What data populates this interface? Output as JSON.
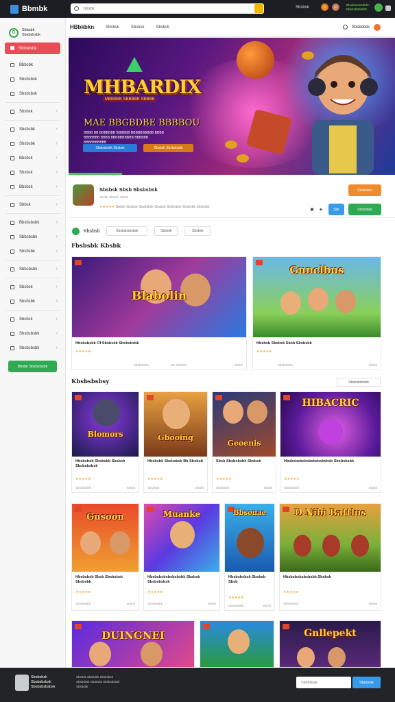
{
  "topbar": {
    "logo": "Bbmbk",
    "search_placeholder": "Sbsbk",
    "nav_link": "Sbsbsk",
    "user_text": "Bhubkubinbbbbn Bbbbnbbbbbbb"
  },
  "sidebar": {
    "title": "Sbbsbk Sbsbsbsbk",
    "active": "Sbbsbsbk",
    "items": [
      "Bbbsbk",
      "Sbsbsbsk",
      "Sbsbsbsk",
      "Sbsbsk",
      "Sbsbsbk",
      "Sbsbsbk",
      "Bbsbsk",
      "Sbsbsk",
      "Bbsbsk",
      "Sbsbsbk",
      "Sbbsk",
      "Bbsbsbsbk",
      "Sbbsbsbk",
      "Sbsbsbk",
      "Sbbsbsbk",
      "Sbsbsk",
      "Sbsbsbk",
      "Sbsbsk",
      "Sbsbsbsbk",
      "Sbsbsbsbk"
    ],
    "cta": "Bbsbk Sbsbsbsbk"
  },
  "subnav": {
    "brand": "HBbkbkn",
    "tabs": [
      "Sbsbsk",
      "Sbsbsk",
      "Sbsbsk"
    ],
    "right_label": "Sbsbsbsk"
  },
  "hero": {
    "title": "MHBARDIX",
    "subtitle": "MBBBBK SBBBBK SBBBB",
    "headline": "MAE BBGBDBE BBBBOU",
    "desc": "BBBB BB BBBBBBB BBBBBB BBBBBBBBBB BBBB BBBBBBB BBBB BBBBBBBBBB BBBBBB BBBBBBBBBB",
    "btn_primary": "Sbsbsbsbk Sbsbsk",
    "btn_secondary": "Sbsbsk Sbsbsbsbk"
  },
  "featured_app": {
    "name": "Sbsbsk Sbsb Sbsbsbsk",
    "meta": "Sbsbk Sbsbsk Sbsbk",
    "rating_stars": "★★★★★",
    "rating_text": "Sbsbk  Sbsbsk Sbsbsbsk Sbsbsk Sbsbsbsk Sbsbsbk Sbsbsbk",
    "btn_top": "Sbsbsbsk",
    "btn_small": "Sbk",
    "btn_green": "Sbsbsbsk"
  },
  "filters": {
    "label": "Kbsbsb",
    "chips": [
      "Sbsbsbsbsbsk",
      "Sbsbsk",
      "Sbsbsk"
    ]
  },
  "section1": {
    "title": "Fbsbsbk Kbsbk",
    "cards": [
      {
        "title_art": "Blabolin",
        "name": "Hbsbsbsbk Of Sbsbsbk Sbsbsbsbk",
        "stars": "★★★★★",
        "meta_left": "Sbsbsbsbk",
        "meta_mid": "Sb Sbsbsbk",
        "meta_right": "Sbsbk"
      },
      {
        "title_art": "Gunclbus",
        "name": "Hbsbsb Sbsbsk Sbsb Sbsbsbk",
        "stars": "★★★★★",
        "meta_left": "Sbsbsbsbk",
        "meta_right": "Sbsbk"
      }
    ]
  },
  "section2": {
    "title": "Kbsbsbsbsy",
    "button": "Sbsbsbsbsbk",
    "cards": [
      {
        "title_art": "Blomors",
        "name": "Hbsbsbsb Sbsbsbk Sbsbsb Sbsbsbsbsk",
        "stars": "★★★★★",
        "meta_left": "Sbsbsbsbk",
        "meta_right": "Sbsbk"
      },
      {
        "title_art": "Gbooing",
        "name": "Hbsbsbk Sbsbsbsk Bb Sbsbsb",
        "stars": "★★★★★",
        "meta_left": "Sbsbsbk",
        "meta_right": "Sbsbk"
      },
      {
        "title_art": "Geoenis",
        "name": "Sbsb Sbsbsbsbk Sbsbsb",
        "stars": "★★★★★",
        "meta_left": "Sbsbsbsk",
        "meta_right": "Sbsbk"
      },
      {
        "title_art": "HIBACRIC",
        "name": "Hbsbsbsbsbsbsbsbsbsbsk Sbsbsbsbk",
        "stars": "★★★★★",
        "meta_left": "Sbsbsbsbk",
        "meta_right": "Sbsbk"
      },
      {
        "title_art": "Gusoon",
        "name": "Hbsbsbsb Sbsb Sbsbsbsk Sbsbsbk",
        "stars": "★★★★★",
        "meta_left": "Sbsbsbsbk",
        "meta_right": "Sbsbk"
      },
      {
        "title_art": "Muanke",
        "name": "Hbsbsbsbsbsbsbsbk Sbsbsb Sbsbsbsbsk",
        "stars": "★★★★★",
        "meta_left": "Sbsbsbsbk",
        "meta_right": "Sbsbk"
      },
      {
        "title_art": "Bbsonae",
        "name": "Hbsbsbsbsk Sbsbsb Sbsb",
        "stars": "★★★★★",
        "meta_left": "Sbsbsbsbk",
        "meta_right": "Sbsbk"
      },
      {
        "title_art": "D Nibi Battlus",
        "name": "Hbsbsbsbsbsbsbk Sbsbsk",
        "stars": "★★★★★",
        "meta_left": "Sbsbsbsbk",
        "meta_right": "Sbsbk"
      },
      {
        "title_art": "DUINGNEI",
        "name": "",
        "stars": "",
        "meta_left": "",
        "meta_right": ""
      },
      {
        "title_art": "",
        "name": "",
        "stars": "",
        "meta_left": "",
        "meta_right": ""
      },
      {
        "title_art": "Gnllepekt",
        "name": "",
        "stars": "",
        "meta_left": "",
        "meta_right": ""
      }
    ]
  },
  "footer": {
    "brand": "Sbsbsbsk Sbsbsbsbsk Sbsbsbsbsbsk",
    "col": "Sbsbsk Sbsbsbk Sbsbsbsk Sbsbsbsk Sbsbsbk Sbsbsbsbsk Sbsbsbk",
    "input_placeholder": "Sbsbsbsk",
    "button": "Sbsbsbk"
  },
  "colors": {
    "accent_red": "#e84d55",
    "accent_green": "#2faa54",
    "accent_blue": "#3a9ae8",
    "accent_orange": "#f08a2a",
    "star": "#f5a623"
  }
}
